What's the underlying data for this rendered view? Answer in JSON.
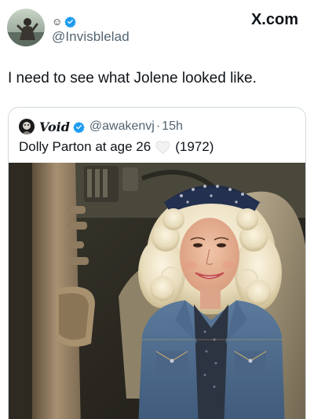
{
  "post": {
    "author_display_glyph": "☺",
    "author_handle": "@Invisblelad",
    "site": "X.com",
    "text": "I need to see what Jolene looked like."
  },
  "quote": {
    "author_name": "Void",
    "author_handle": "@awakenvj",
    "separator": "·",
    "time": "15h",
    "text_before": "Dolly Parton at age 26",
    "text_after": "(1972)",
    "emoji": "white-heart-icon"
  },
  "colors": {
    "text_primary": "#0f1419",
    "text_secondary": "#536471",
    "verified_blue": "#1d9bf0",
    "border": "#cfd9de"
  }
}
